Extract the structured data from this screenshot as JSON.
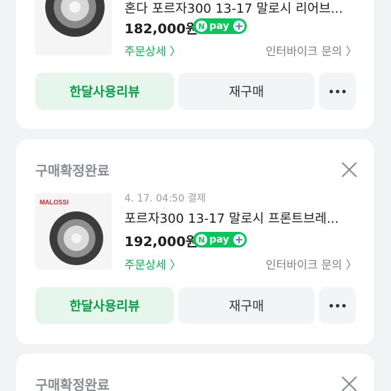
{
  "orders": [
    {
      "status": "",
      "date": "",
      "title": "혼다 포르자300 13-17 말로시 리어브...",
      "price": "182,000원",
      "detail_label": "주문상세 〉",
      "inquiry_label": "인터바이크 문의 〉",
      "review_label": "한달사용리뷰",
      "rebuy_label": "재구매"
    },
    {
      "status": "구매확정완료",
      "date": "4. 17. 04:50 결제",
      "title": "포르자300 13-17 말로시 프론트브레...",
      "price": "192,000원",
      "detail_label": "주문상세 〉",
      "inquiry_label": "인터바이크 문의 〉",
      "review_label": "한달사용리뷰",
      "rebuy_label": "재구매",
      "brand": "MALOSSI"
    },
    {
      "status": "구매확정완료"
    }
  ],
  "npay": {
    "n": "N",
    "label": "pay",
    "plus": "+"
  },
  "colors": {
    "accent_green": "#07c75a",
    "review_bg": "#e7f6ec",
    "status_gray": "#888c92"
  }
}
